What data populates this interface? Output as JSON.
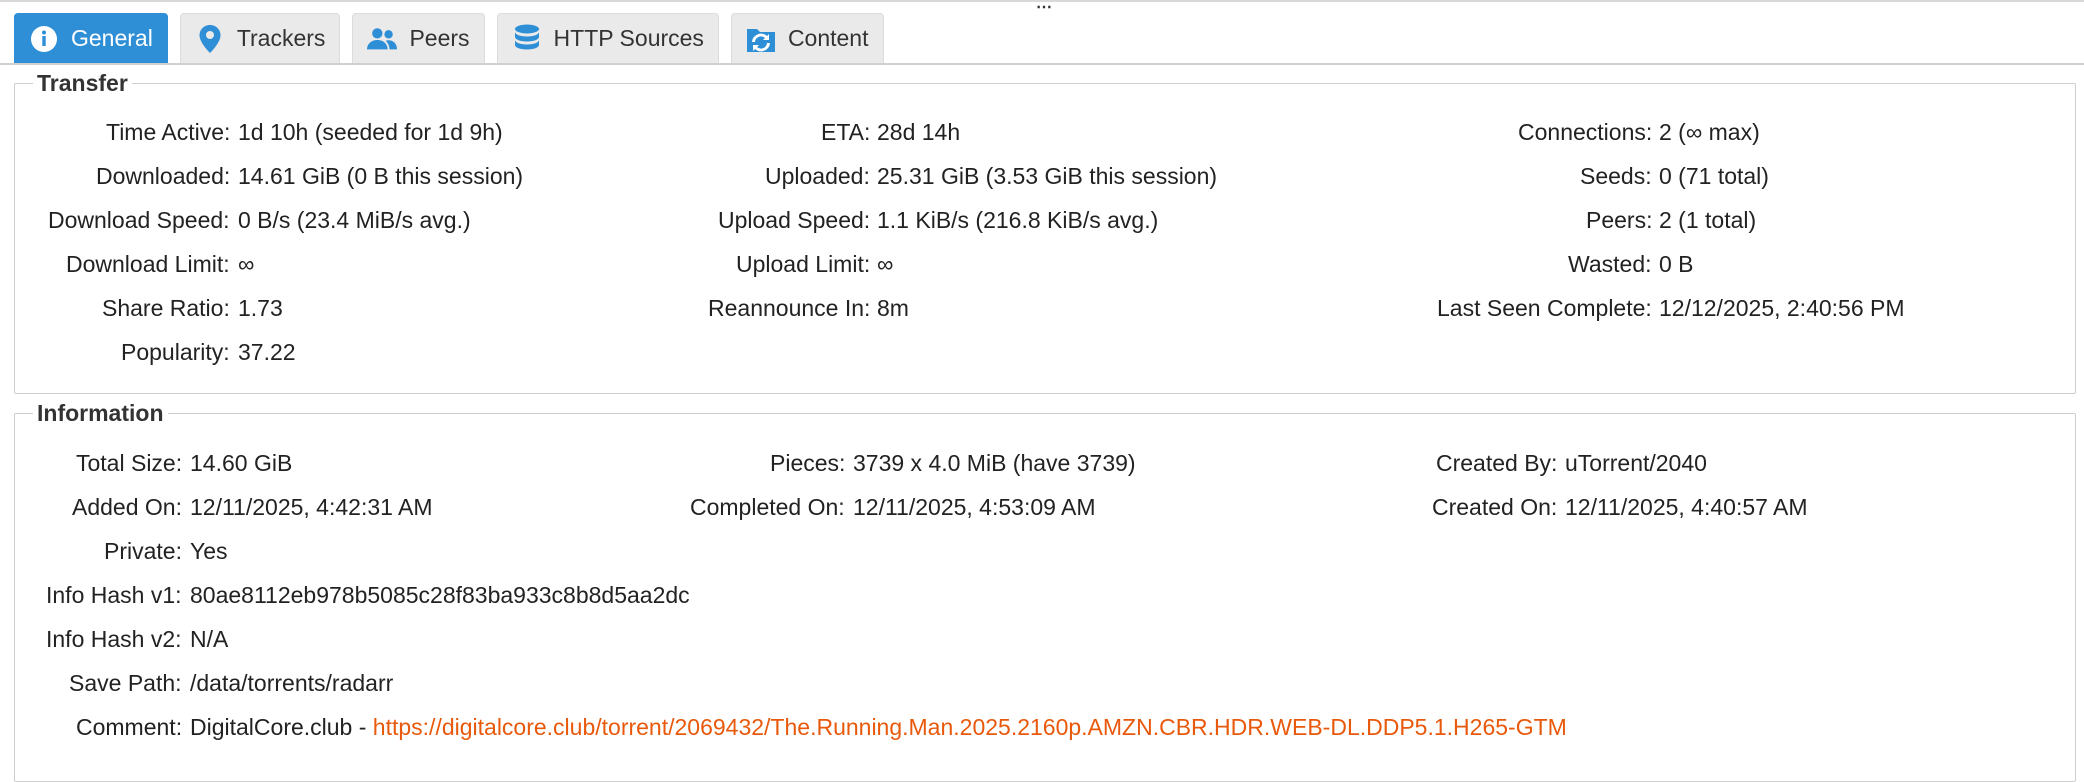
{
  "tabs": [
    {
      "label": "General",
      "icon": "info-icon",
      "active": true
    },
    {
      "label": "Trackers",
      "icon": "map-pin-icon",
      "active": false
    },
    {
      "label": "Peers",
      "icon": "users-icon",
      "active": false
    },
    {
      "label": "HTTP Sources",
      "icon": "database-icon",
      "active": false
    },
    {
      "label": "Content",
      "icon": "folder-sync-icon",
      "active": false
    }
  ],
  "transfer": {
    "title": "Transfer",
    "col1": [
      {
        "label": "Time Active:",
        "value": "1d 10h (seeded for 1d 9h)"
      },
      {
        "label": "Downloaded:",
        "value": "14.61 GiB (0 B this session)"
      },
      {
        "label": "Download Speed:",
        "value": "0 B/s (23.4 MiB/s avg.)"
      },
      {
        "label": "Download Limit:",
        "value": "∞"
      },
      {
        "label": "Share Ratio:",
        "value": "1.73"
      },
      {
        "label": "Popularity:",
        "value": "37.22"
      }
    ],
    "col2": [
      {
        "label": "ETA:",
        "value": "28d 14h"
      },
      {
        "label": "Uploaded:",
        "value": "25.31 GiB (3.53 GiB this session)"
      },
      {
        "label": "Upload Speed:",
        "value": "1.1 KiB/s (216.8 KiB/s avg.)"
      },
      {
        "label": "Upload Limit:",
        "value": "∞"
      },
      {
        "label": "Reannounce In:",
        "value": "8m"
      }
    ],
    "col3": [
      {
        "label": "Connections:",
        "value": "2 (∞ max)"
      },
      {
        "label": "Seeds:",
        "value": "0 (71 total)"
      },
      {
        "label": "Peers:",
        "value": "2 (1 total)"
      },
      {
        "label": "Wasted:",
        "value": "0 B"
      },
      {
        "label": "Last Seen Complete:",
        "value": "12/12/2025, 2:40:56 PM"
      }
    ]
  },
  "information": {
    "title": "Information",
    "col1": [
      {
        "label": "Total Size:",
        "value": "14.60 GiB"
      },
      {
        "label": "Added On:",
        "value": "12/11/2025, 4:42:31 AM"
      },
      {
        "label": "Private:",
        "value": "Yes"
      },
      {
        "label": "Info Hash v1:",
        "value": "80ae8112eb978b5085c28f83ba933c8b8d5aa2dc"
      },
      {
        "label": "Info Hash v2:",
        "value": "N/A"
      },
      {
        "label": "Save Path:",
        "value": "/data/torrents/radarr"
      }
    ],
    "col2": [
      {
        "label": "Pieces:",
        "value": "3739 x 4.0 MiB (have 3739)"
      },
      {
        "label": "Completed On:",
        "value": "12/11/2025, 4:53:09 AM"
      }
    ],
    "col3": [
      {
        "label": "Created By:",
        "value": "uTorrent/2040"
      },
      {
        "label": "Created On:",
        "value": "12/11/2025, 4:40:57 AM"
      }
    ],
    "comment": {
      "label": "Comment:",
      "prefix": "DigitalCore.club - ",
      "link": "https://digitalcore.club/torrent/2069432/The.Running.Man.2025.2160p.AMZN.CBR.HDR.WEB-DL.DDP5.1.H265-GTM"
    }
  },
  "colors": {
    "accent": "#2f8fd6",
    "link": "#e8590c",
    "tab_bg": "#eaeaea"
  }
}
